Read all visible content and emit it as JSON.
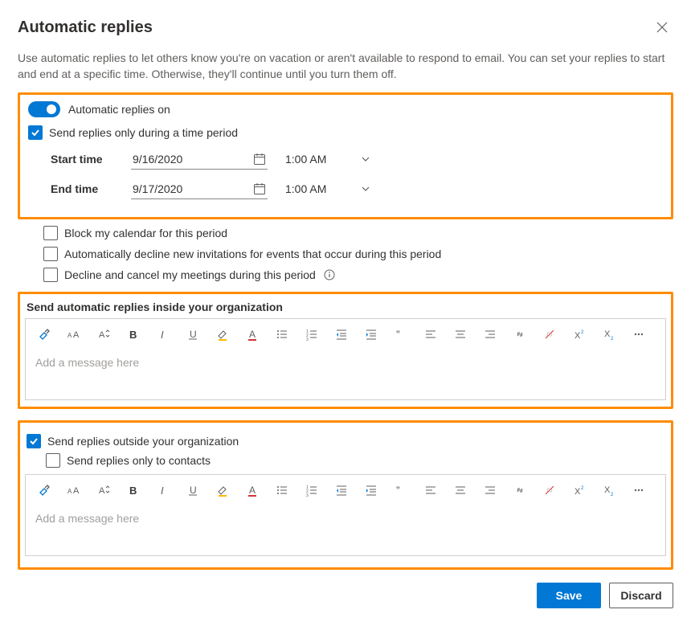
{
  "header": {
    "title": "Automatic replies"
  },
  "description": "Use automatic replies to let others know you're on vacation or aren't available to respond to email. You can set your replies to start and end at a specific time. Otherwise, they'll continue until you turn them off.",
  "settings": {
    "toggle_label": "Automatic replies on",
    "time_period_label": "Send replies only during a time period",
    "start_label": "Start time",
    "start_date": "9/16/2020",
    "start_time": "1:00 AM",
    "end_label": "End time",
    "end_date": "9/17/2020",
    "end_time": "1:00 AM",
    "block_calendar": "Block my calendar for this period",
    "decline_new": "Automatically decline new invitations for events that occur during this period",
    "decline_cancel": "Decline and cancel my meetings during this period"
  },
  "org": {
    "title": "Send automatic replies inside your organization",
    "placeholder": "Add a message here"
  },
  "ext": {
    "enable_label": "Send replies outside your organization",
    "contacts_only_label": "Send replies only to contacts",
    "placeholder": "Add a message here"
  },
  "footer": {
    "save": "Save",
    "discard": "Discard"
  }
}
